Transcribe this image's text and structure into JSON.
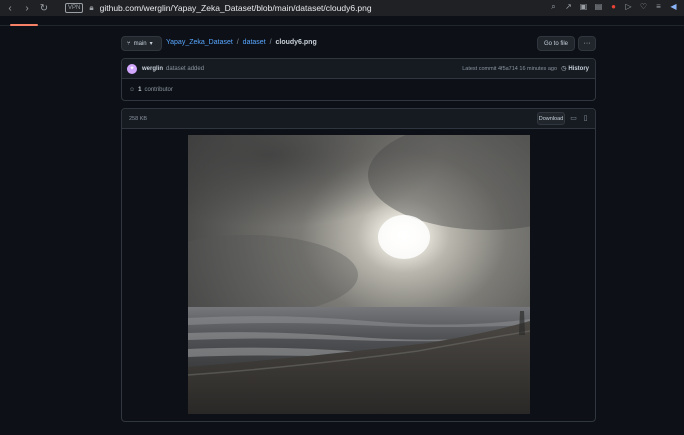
{
  "browser": {
    "vpn_label": "VPN",
    "url": "github.com/werglin/Yapay_Zeka_Dataset/blob/main/dataset/cloudy6.png"
  },
  "repo_nav": {
    "branch_label": "main",
    "repo_link": "Yapay_Zeka_Dataset",
    "separator": "/",
    "folder_link": "dataset",
    "file_name": "cloudy6.png",
    "go_to_file_label": "Go to file",
    "more_label": "···"
  },
  "commit": {
    "author": "werglin",
    "message": "dataset added",
    "latest_commit": "Latest commit 4f5a714 16 minutes ago",
    "history_label": "History",
    "contributors": "1",
    "contributors_label": "contributor"
  },
  "file": {
    "size": "258 KB",
    "download_label": "Download"
  },
  "colors": {
    "accent": "#58a6ff",
    "tab_underline": "#f78166"
  }
}
